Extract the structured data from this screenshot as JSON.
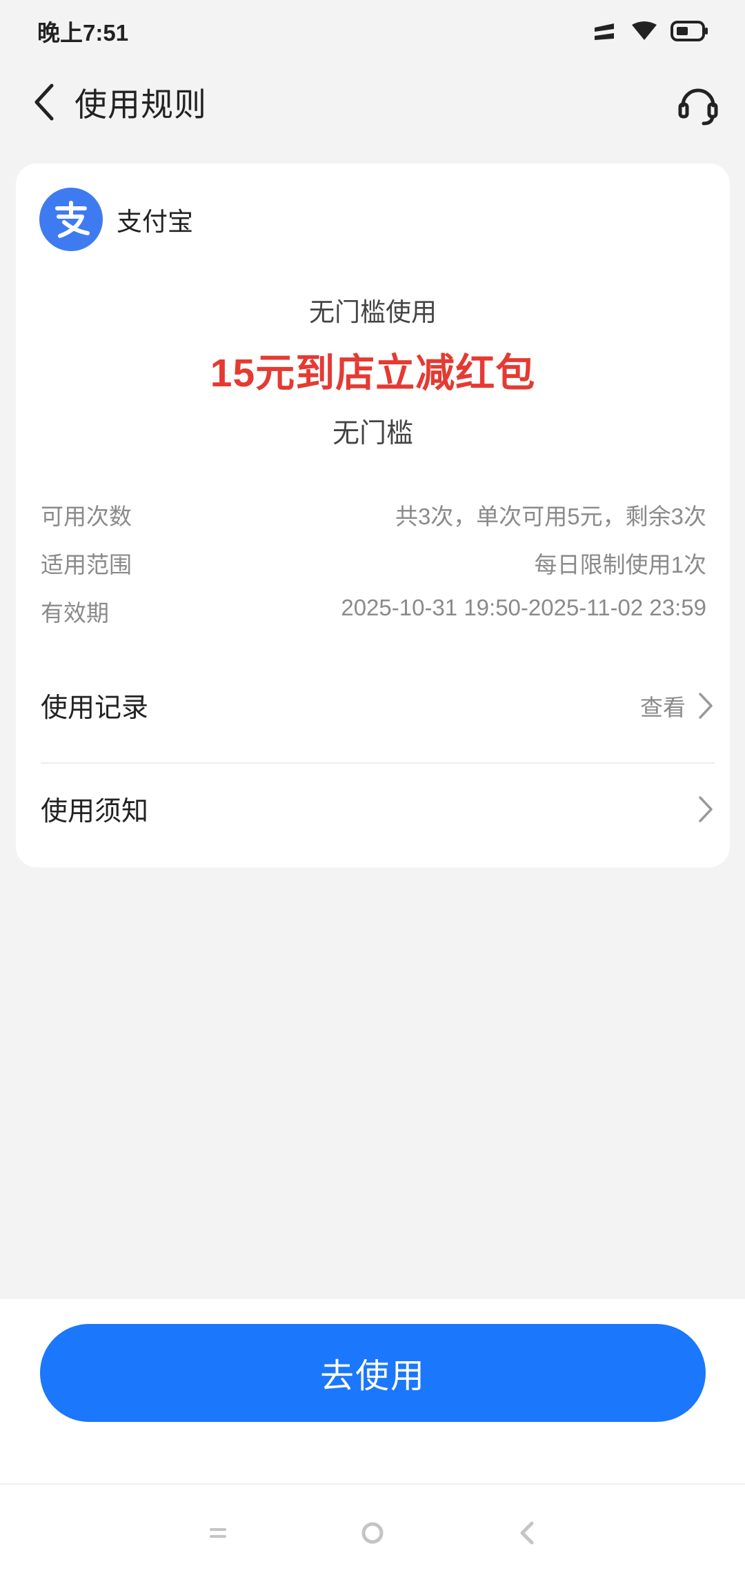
{
  "status_bar": {
    "time": "晚上7:51"
  },
  "nav": {
    "title": "使用规则",
    "back_icon": "chevron-left-icon",
    "support_icon": "headset-icon"
  },
  "card": {
    "brand": {
      "name": "支付宝",
      "logo_glyph": "支",
      "logo_color": "#3f7bf0"
    },
    "coupon": {
      "subtitle": "无门槛使用",
      "title": "15元到店立减红包",
      "condition": "无门槛"
    },
    "info": [
      {
        "label": "可用次数",
        "value": "共3次，单次可用5元，剩余3次"
      },
      {
        "label": "适用范围",
        "value": "每日限制使用1次"
      },
      {
        "label": "有效期",
        "value": "2025-10-31 19:50-2025-11-02 23:59"
      }
    ],
    "links": [
      {
        "label": "使用记录",
        "value": "查看"
      },
      {
        "label": "使用须知",
        "value": ""
      }
    ]
  },
  "action": {
    "button_label": "去使用",
    "button_color": "#1b77fb"
  },
  "colors": {
    "accent": "#1b77fb",
    "highlight": "#e53a32",
    "background": "#f3f3f3"
  }
}
